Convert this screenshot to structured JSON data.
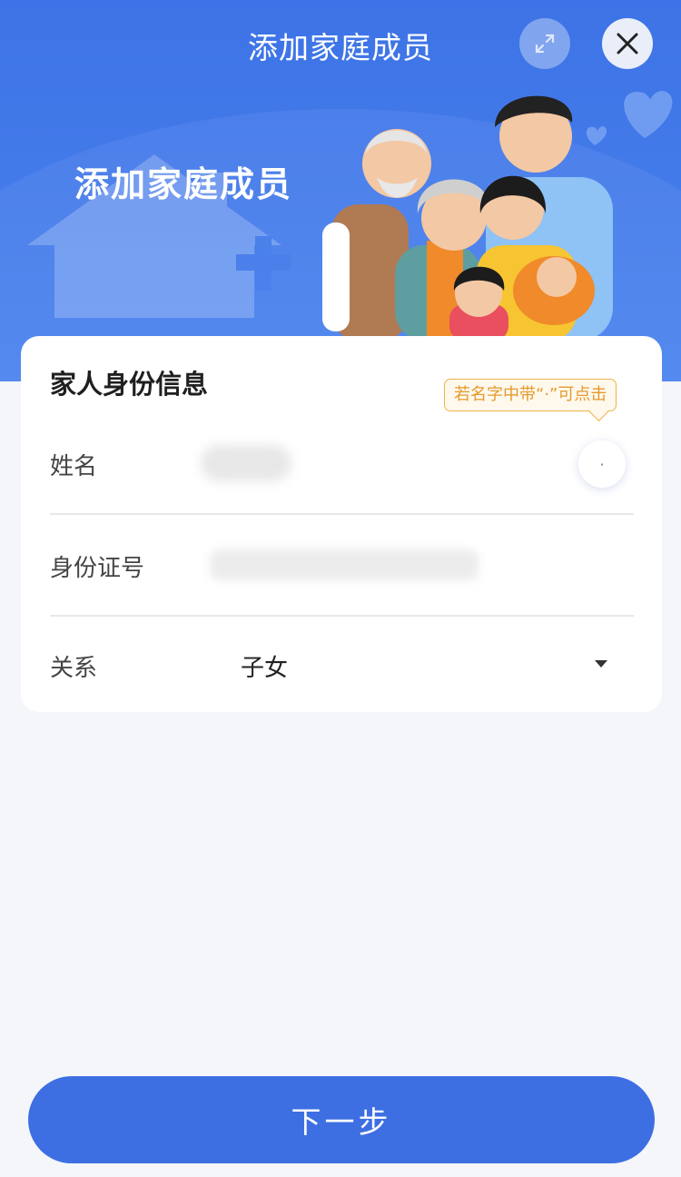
{
  "header": {
    "title": "添加家庭成员",
    "hero_title": "添加家庭成员"
  },
  "form": {
    "section_title": "家人身份信息",
    "tip": "若名字中带“·”可点击",
    "name_label": "姓名",
    "dot_button": "·",
    "id_label": "身份证号",
    "relation_label": "关系",
    "relation_value": "子女"
  },
  "footer": {
    "next_label": "下一步"
  },
  "colors": {
    "primary": "#3d6fe3",
    "tip_border": "#f0b24a",
    "tip_text": "#e49a2c"
  },
  "icons": [
    "expand-icon",
    "close-icon",
    "dropdown-caret-icon",
    "house-illustration",
    "family-illustration",
    "heart-icon"
  ]
}
